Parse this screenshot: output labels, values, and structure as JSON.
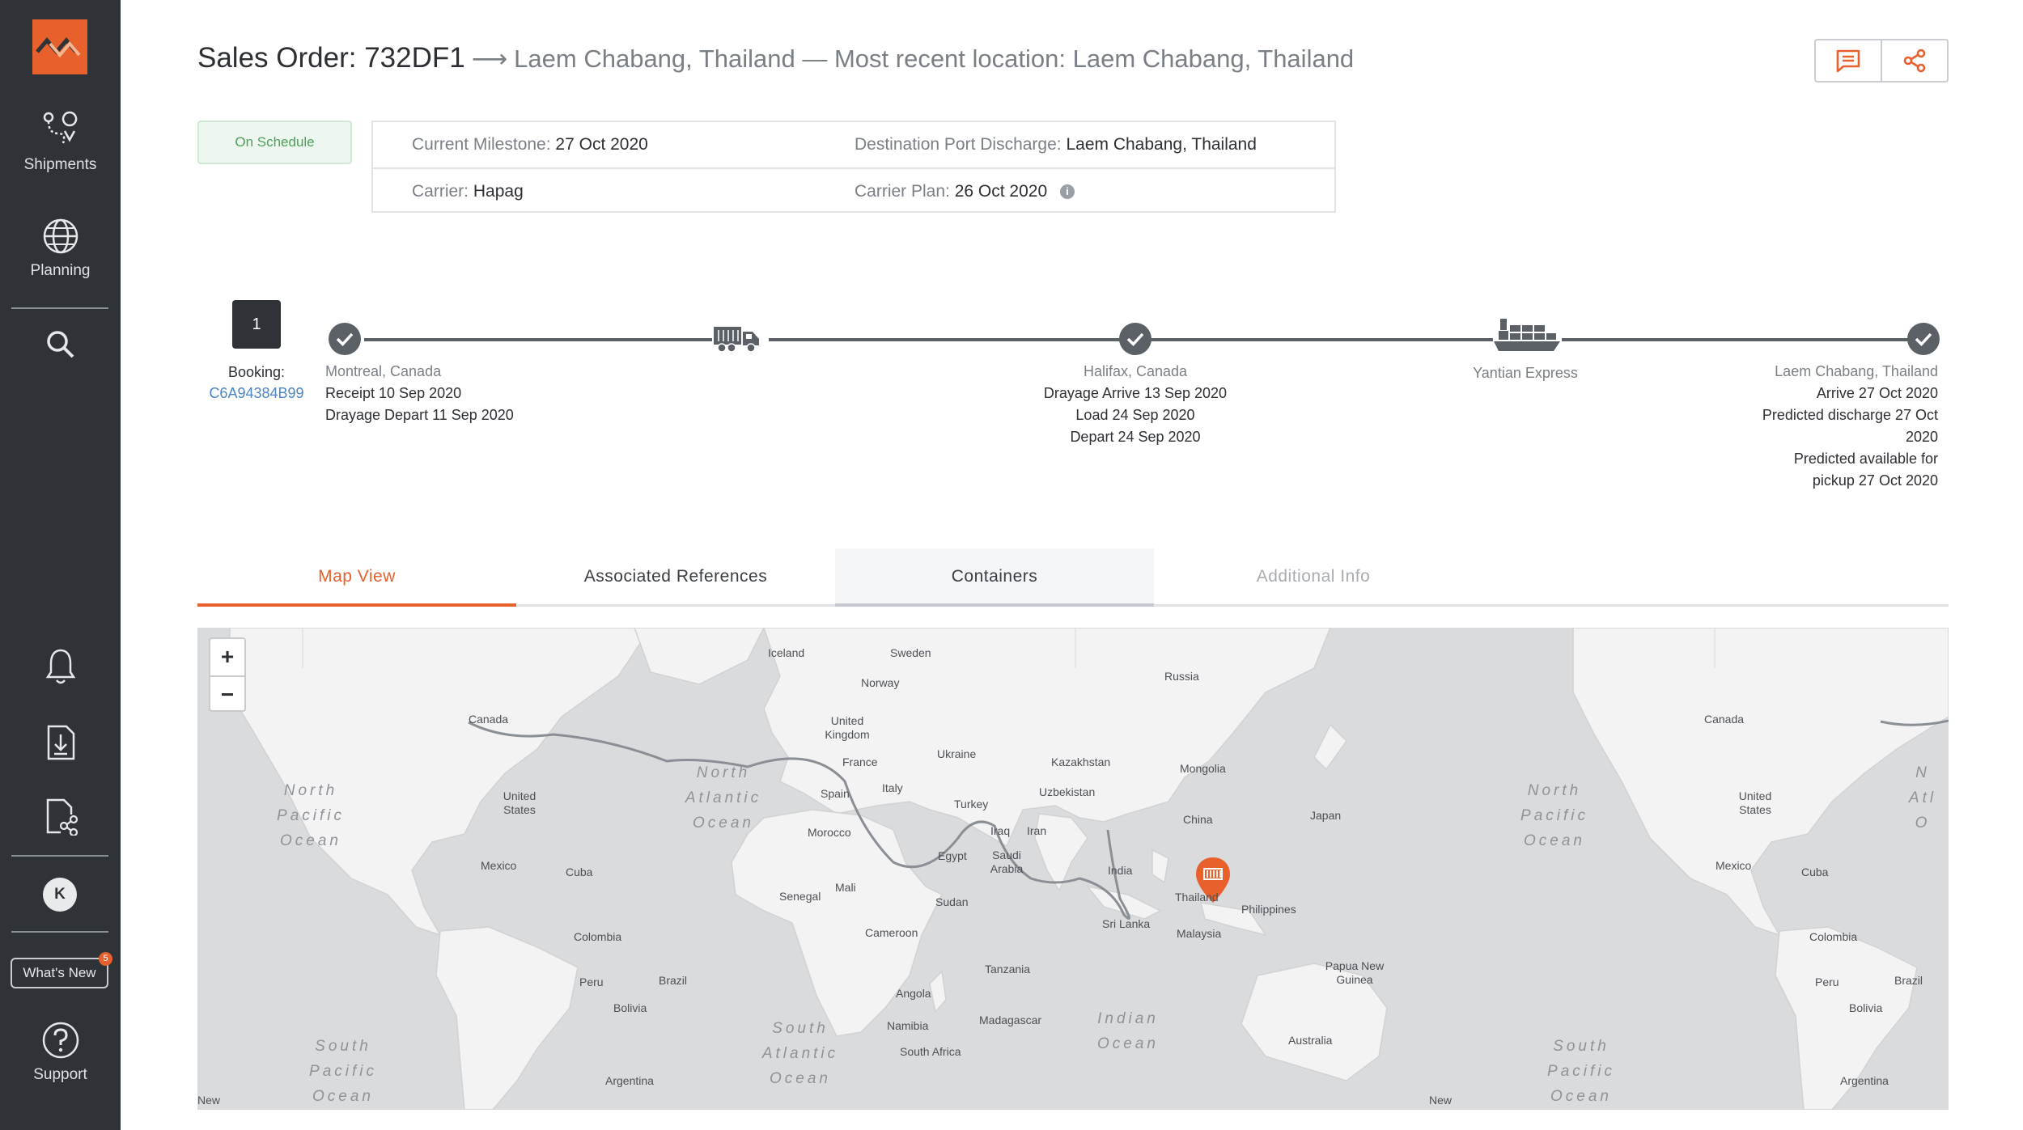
{
  "sidebar": {
    "items": [
      {
        "label": "Shipments",
        "icon": "route-pin-icon"
      },
      {
        "label": "Planning",
        "icon": "globe-icon"
      }
    ],
    "search_icon": "search-icon",
    "bottom_icons": [
      "bell-icon",
      "download-document-icon",
      "share-document-icon"
    ],
    "avatar_initial": "K",
    "whats_new": {
      "label": "What's New",
      "count": "5"
    },
    "support": {
      "label": "Support",
      "icon": "help-icon"
    }
  },
  "header": {
    "title": "Sales Order: 732DF1",
    "arrow": "⟶",
    "subtitle": "Laem Chabang, Thailand — Most recent location: Laem Chabang, Thailand",
    "actions": [
      "comment-icon",
      "share-icon"
    ]
  },
  "status": "On Schedule",
  "info": {
    "current_milestone_label": "Current Milestone:",
    "current_milestone_value": "27 Oct 2020",
    "destination_label": "Destination Port Discharge:",
    "destination_value": "Laem Chabang, Thailand",
    "carrier_label": "Carrier:",
    "carrier_value": "Hapag",
    "carrier_plan_label": "Carrier Plan:",
    "carrier_plan_value": "26 Oct 2020",
    "info_glyph": "i"
  },
  "timeline": {
    "booking": {
      "number": "1",
      "label": "Booking:",
      "id": "C6A94384B99"
    },
    "stops": [
      {
        "place": "Montreal, Canada",
        "lines": [
          "Receipt 10 Sep 2020",
          "Drayage Depart 11 Sep 2020"
        ]
      },
      {
        "place": "Halifax, Canada",
        "lines": [
          "Drayage Arrive 13 Sep 2020",
          "Load 24 Sep 2020",
          "Depart 24 Sep 2020"
        ]
      },
      {
        "place": "Yantian Express",
        "lines": []
      },
      {
        "place": "Laem Chabang, Thailand",
        "lines": [
          "Arrive 27 Oct 2020",
          "Predicted discharge 27 Oct",
          "2020",
          "Predicted available for",
          "pickup 27 Oct 2020"
        ]
      }
    ]
  },
  "tabs": [
    {
      "label": "Map View",
      "state": "active"
    },
    {
      "label": "Associated References",
      "state": "normal"
    },
    {
      "label": "Containers",
      "state": "hover"
    },
    {
      "label": "Additional Info",
      "state": "disabled"
    }
  ],
  "map": {
    "zoom_in": "+",
    "zoom_out": "−",
    "countries": [
      "Iceland",
      "Sweden",
      "Norway",
      "Russia",
      "United Kingdom",
      "Canada",
      "Ukraine",
      "Kazakhstan",
      "France",
      "Mongolia",
      "Spain",
      "Italy",
      "Uzbekistan",
      "Turkey",
      "United States",
      "China",
      "Japan",
      "Iraq",
      "Iran",
      "Morocco",
      "Egypt",
      "Saudi Arabia",
      "Mexico",
      "Cuba",
      "India",
      "Thailand",
      "Mali",
      "Senegal",
      "Sudan",
      "Philippines",
      "Sri Lanka",
      "Malaysia",
      "Colombia",
      "Cameroon",
      "Tanzania",
      "Peru",
      "Brazil",
      "Papua New Guinea",
      "Angola",
      "Bolivia",
      "Namibia",
      "Madagascar",
      "South Africa",
      "Australia",
      "Argentina",
      "Canada",
      "United States",
      "Mexico",
      "Cuba",
      "Colombia",
      "Peru",
      "Brazil",
      "Bolivia",
      "Argentina",
      "New",
      "New"
    ],
    "oceans": [
      "North Pacific Ocean",
      "North Atlantic Ocean",
      "North Pacific Ocean",
      "South Pacific Ocean",
      "South Atlantic Ocean",
      "Indian Ocean",
      "South Pacific Ocean",
      "N Atl O"
    ],
    "marker_icon": "container-pin-icon",
    "colors": {
      "accent": "#e8612c",
      "route": "#8a8f96",
      "water": "#dadbdc",
      "land": "#f2f2f2"
    }
  }
}
